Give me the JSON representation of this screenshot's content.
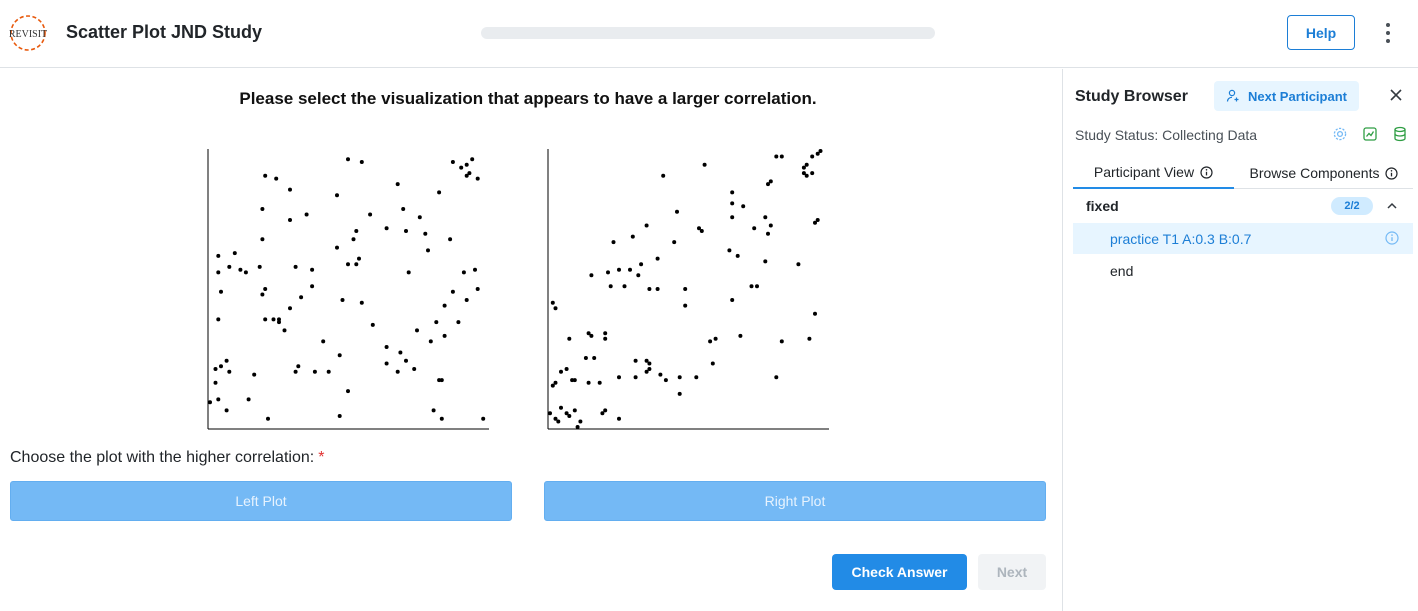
{
  "header": {
    "title": "Scatter Plot JND Study",
    "logo_text": "REVISIT",
    "help_label": "Help",
    "progress": 0
  },
  "main": {
    "prompt": "Please select the visualization that appears to have a larger correlation.",
    "question": "Choose the plot with the higher correlation:",
    "required_mark": "*",
    "left_button": "Left Plot",
    "right_button": "Right Plot",
    "check_answer": "Check Answer",
    "next": "Next"
  },
  "plots": {
    "point_color": "#000000",
    "left": {
      "correlation": 0.3,
      "points": [
        [
          0.93,
          0.95
        ],
        [
          0.95,
          0.97
        ],
        [
          0.88,
          0.96
        ],
        [
          0.91,
          0.94
        ],
        [
          0.93,
          0.91
        ],
        [
          0.97,
          0.9
        ],
        [
          0.94,
          0.92
        ],
        [
          0.83,
          0.85
        ],
        [
          0.68,
          0.88
        ],
        [
          0.5,
          0.97
        ],
        [
          0.55,
          0.96
        ],
        [
          0.2,
          0.91
        ],
        [
          0.24,
          0.9
        ],
        [
          0.29,
          0.86
        ],
        [
          0.19,
          0.79
        ],
        [
          0.46,
          0.84
        ],
        [
          0.58,
          0.77
        ],
        [
          0.7,
          0.79
        ],
        [
          0.76,
          0.76
        ],
        [
          0.78,
          0.7
        ],
        [
          0.71,
          0.71
        ],
        [
          0.64,
          0.72
        ],
        [
          0.53,
          0.71
        ],
        [
          0.79,
          0.64
        ],
        [
          0.87,
          0.68
        ],
        [
          0.92,
          0.56
        ],
        [
          0.96,
          0.57
        ],
        [
          0.93,
          0.46
        ],
        [
          0.97,
          0.5
        ],
        [
          0.88,
          0.49
        ],
        [
          0.85,
          0.33
        ],
        [
          0.9,
          0.38
        ],
        [
          0.82,
          0.38
        ],
        [
          0.85,
          0.44
        ],
        [
          0.72,
          0.56
        ],
        [
          0.52,
          0.68
        ],
        [
          0.54,
          0.61
        ],
        [
          0.53,
          0.59
        ],
        [
          0.5,
          0.59
        ],
        [
          0.46,
          0.65
        ],
        [
          0.35,
          0.77
        ],
        [
          0.29,
          0.75
        ],
        [
          0.19,
          0.68
        ],
        [
          0.18,
          0.58
        ],
        [
          0.31,
          0.58
        ],
        [
          0.37,
          0.57
        ],
        [
          0.37,
          0.51
        ],
        [
          0.33,
          0.47
        ],
        [
          0.29,
          0.43
        ],
        [
          0.25,
          0.38
        ],
        [
          0.2,
          0.39
        ],
        [
          0.2,
          0.5
        ],
        [
          0.23,
          0.39
        ],
        [
          0.19,
          0.48
        ],
        [
          0.25,
          0.39
        ],
        [
          0.27,
          0.35
        ],
        [
          0.13,
          0.56
        ],
        [
          0.11,
          0.57
        ],
        [
          0.09,
          0.63
        ],
        [
          0.07,
          0.58
        ],
        [
          0.03,
          0.62
        ],
        [
          0.03,
          0.56
        ],
        [
          0.04,
          0.49
        ],
        [
          0.03,
          0.39
        ],
        [
          0.41,
          0.31
        ],
        [
          0.48,
          0.46
        ],
        [
          0.55,
          0.45
        ],
        [
          0.59,
          0.37
        ],
        [
          0.64,
          0.29
        ],
        [
          0.69,
          0.27
        ],
        [
          0.71,
          0.24
        ],
        [
          0.68,
          0.2
        ],
        [
          0.74,
          0.21
        ],
        [
          0.64,
          0.23
        ],
        [
          0.75,
          0.35
        ],
        [
          0.8,
          0.31
        ],
        [
          0.83,
          0.17
        ],
        [
          0.84,
          0.17
        ],
        [
          0.5,
          0.13
        ],
        [
          0.47,
          0.26
        ],
        [
          0.43,
          0.2
        ],
        [
          0.38,
          0.2
        ],
        [
          0.32,
          0.22
        ],
        [
          0.31,
          0.2
        ],
        [
          0.16,
          0.19
        ],
        [
          0.04,
          0.22
        ],
        [
          0.02,
          0.21
        ],
        [
          0.06,
          0.24
        ],
        [
          0.07,
          0.2
        ],
        [
          0.02,
          0.16
        ],
        [
          0.03,
          0.1
        ],
        [
          0.0,
          0.09
        ],
        [
          0.14,
          0.1
        ],
        [
          0.06,
          0.06
        ],
        [
          0.21,
          0.03
        ],
        [
          0.47,
          0.04
        ],
        [
          0.81,
          0.06
        ],
        [
          0.84,
          0.03
        ],
        [
          0.99,
          0.03
        ]
      ]
    },
    "right": {
      "correlation": 0.7,
      "points": [
        [
          0.98,
          1.0
        ],
        [
          0.97,
          0.99
        ],
        [
          0.95,
          0.98
        ],
        [
          0.84,
          0.98
        ],
        [
          0.82,
          0.98
        ],
        [
          0.93,
          0.95
        ],
        [
          0.92,
          0.94
        ],
        [
          0.95,
          0.92
        ],
        [
          0.92,
          0.92
        ],
        [
          0.93,
          0.91
        ],
        [
          0.56,
          0.95
        ],
        [
          0.41,
          0.91
        ],
        [
          0.8,
          0.89
        ],
        [
          0.79,
          0.88
        ],
        [
          0.66,
          0.85
        ],
        [
          0.66,
          0.81
        ],
        [
          0.7,
          0.8
        ],
        [
          0.66,
          0.76
        ],
        [
          0.78,
          0.76
        ],
        [
          0.8,
          0.73
        ],
        [
          0.97,
          0.75
        ],
        [
          0.96,
          0.74
        ],
        [
          0.79,
          0.7
        ],
        [
          0.74,
          0.72
        ],
        [
          0.54,
          0.72
        ],
        [
          0.55,
          0.71
        ],
        [
          0.65,
          0.64
        ],
        [
          0.68,
          0.62
        ],
        [
          0.78,
          0.6
        ],
        [
          0.9,
          0.59
        ],
        [
          0.46,
          0.78
        ],
        [
          0.35,
          0.73
        ],
        [
          0.3,
          0.69
        ],
        [
          0.45,
          0.67
        ],
        [
          0.23,
          0.67
        ],
        [
          0.39,
          0.61
        ],
        [
          0.33,
          0.59
        ],
        [
          0.29,
          0.57
        ],
        [
          0.32,
          0.55
        ],
        [
          0.21,
          0.56
        ],
        [
          0.15,
          0.55
        ],
        [
          0.22,
          0.51
        ],
        [
          0.27,
          0.51
        ],
        [
          0.36,
          0.5
        ],
        [
          0.39,
          0.5
        ],
        [
          0.49,
          0.5
        ],
        [
          0.49,
          0.44
        ],
        [
          0.66,
          0.46
        ],
        [
          0.73,
          0.51
        ],
        [
          0.75,
          0.51
        ],
        [
          0.96,
          0.41
        ],
        [
          0.84,
          0.31
        ],
        [
          0.25,
          0.57
        ],
        [
          0.01,
          0.45
        ],
        [
          0.02,
          0.43
        ],
        [
          0.07,
          0.32
        ],
        [
          0.14,
          0.34
        ],
        [
          0.2,
          0.32
        ],
        [
          0.15,
          0.33
        ],
        [
          0.2,
          0.34
        ],
        [
          0.16,
          0.25
        ],
        [
          0.13,
          0.25
        ],
        [
          0.06,
          0.21
        ],
        [
          0.08,
          0.17
        ],
        [
          0.02,
          0.16
        ],
        [
          0.01,
          0.15
        ],
        [
          0.04,
          0.2
        ],
        [
          0.09,
          0.17
        ],
        [
          0.14,
          0.16
        ],
        [
          0.18,
          0.16
        ],
        [
          0.25,
          0.18
        ],
        [
          0.31,
          0.18
        ],
        [
          0.31,
          0.24
        ],
        [
          0.35,
          0.24
        ],
        [
          0.36,
          0.23
        ],
        [
          0.36,
          0.21
        ],
        [
          0.35,
          0.2
        ],
        [
          0.4,
          0.19
        ],
        [
          0.42,
          0.17
        ],
        [
          0.47,
          0.18
        ],
        [
          0.53,
          0.18
        ],
        [
          0.59,
          0.23
        ],
        [
          0.6,
          0.32
        ],
        [
          0.69,
          0.33
        ],
        [
          0.82,
          0.18
        ],
        [
          0.94,
          0.32
        ],
        [
          0.47,
          0.12
        ],
        [
          0.58,
          0.31
        ],
        [
          0.19,
          0.05
        ],
        [
          0.2,
          0.06
        ],
        [
          0.25,
          0.03
        ],
        [
          0.11,
          0.02
        ],
        [
          0.04,
          0.07
        ],
        [
          0.06,
          0.05
        ],
        [
          0.07,
          0.04
        ],
        [
          0.09,
          0.06
        ],
        [
          0.02,
          0.03
        ],
        [
          0.0,
          0.05
        ],
        [
          0.03,
          0.02
        ],
        [
          0.1,
          0.0
        ]
      ]
    }
  },
  "sidebar": {
    "title": "Study Browser",
    "next_participant": "Next Participant",
    "status": "Study Status: Collecting Data",
    "tabs": [
      "Participant View",
      "Browse Components"
    ],
    "group": {
      "label": "fixed",
      "badge": "2/2",
      "items": [
        "practice T1 A:0.3 B:0.7",
        "end"
      ]
    }
  },
  "colors": {
    "accent": "#228be6",
    "disabled_choice": "#74b9f5",
    "required": "#e03131"
  }
}
